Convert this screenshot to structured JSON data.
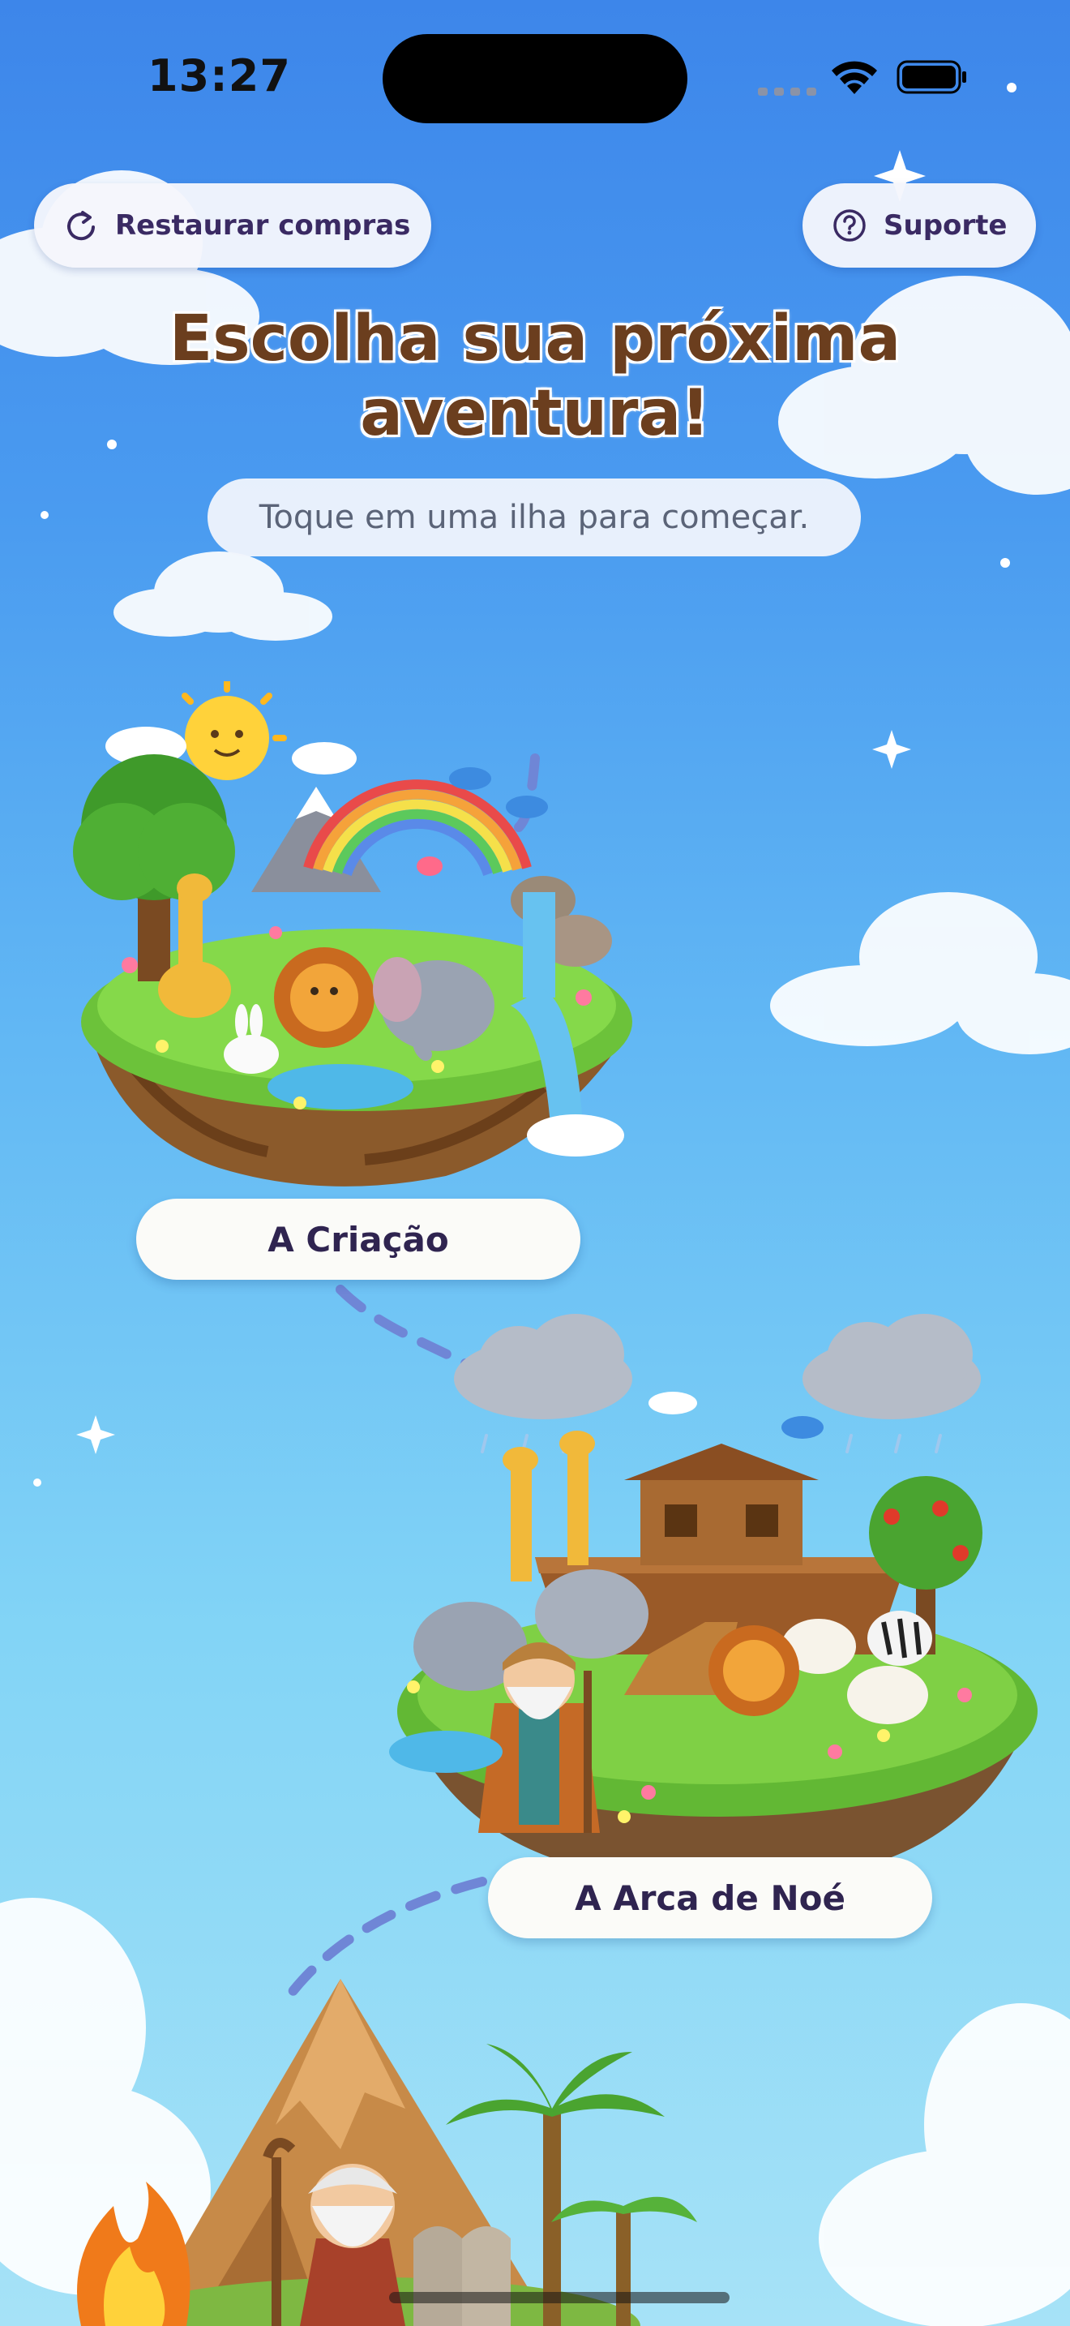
{
  "status_bar": {
    "time": "13:27"
  },
  "header": {
    "restore_label": "Restaurar compras",
    "support_label": "Suporte"
  },
  "main": {
    "title_line1": "Escolha sua próxima",
    "title_line2": "aventura!",
    "subtitle": "Toque em uma ilha para começar."
  },
  "islands": [
    {
      "label": "A Criação"
    },
    {
      "label": "A Arca de Noé"
    }
  ],
  "colors": {
    "sky_top": "#3d86ea",
    "sky_bottom": "#a6e2f7",
    "title": "#6b3e1e",
    "label_text": "#2f2450"
  }
}
